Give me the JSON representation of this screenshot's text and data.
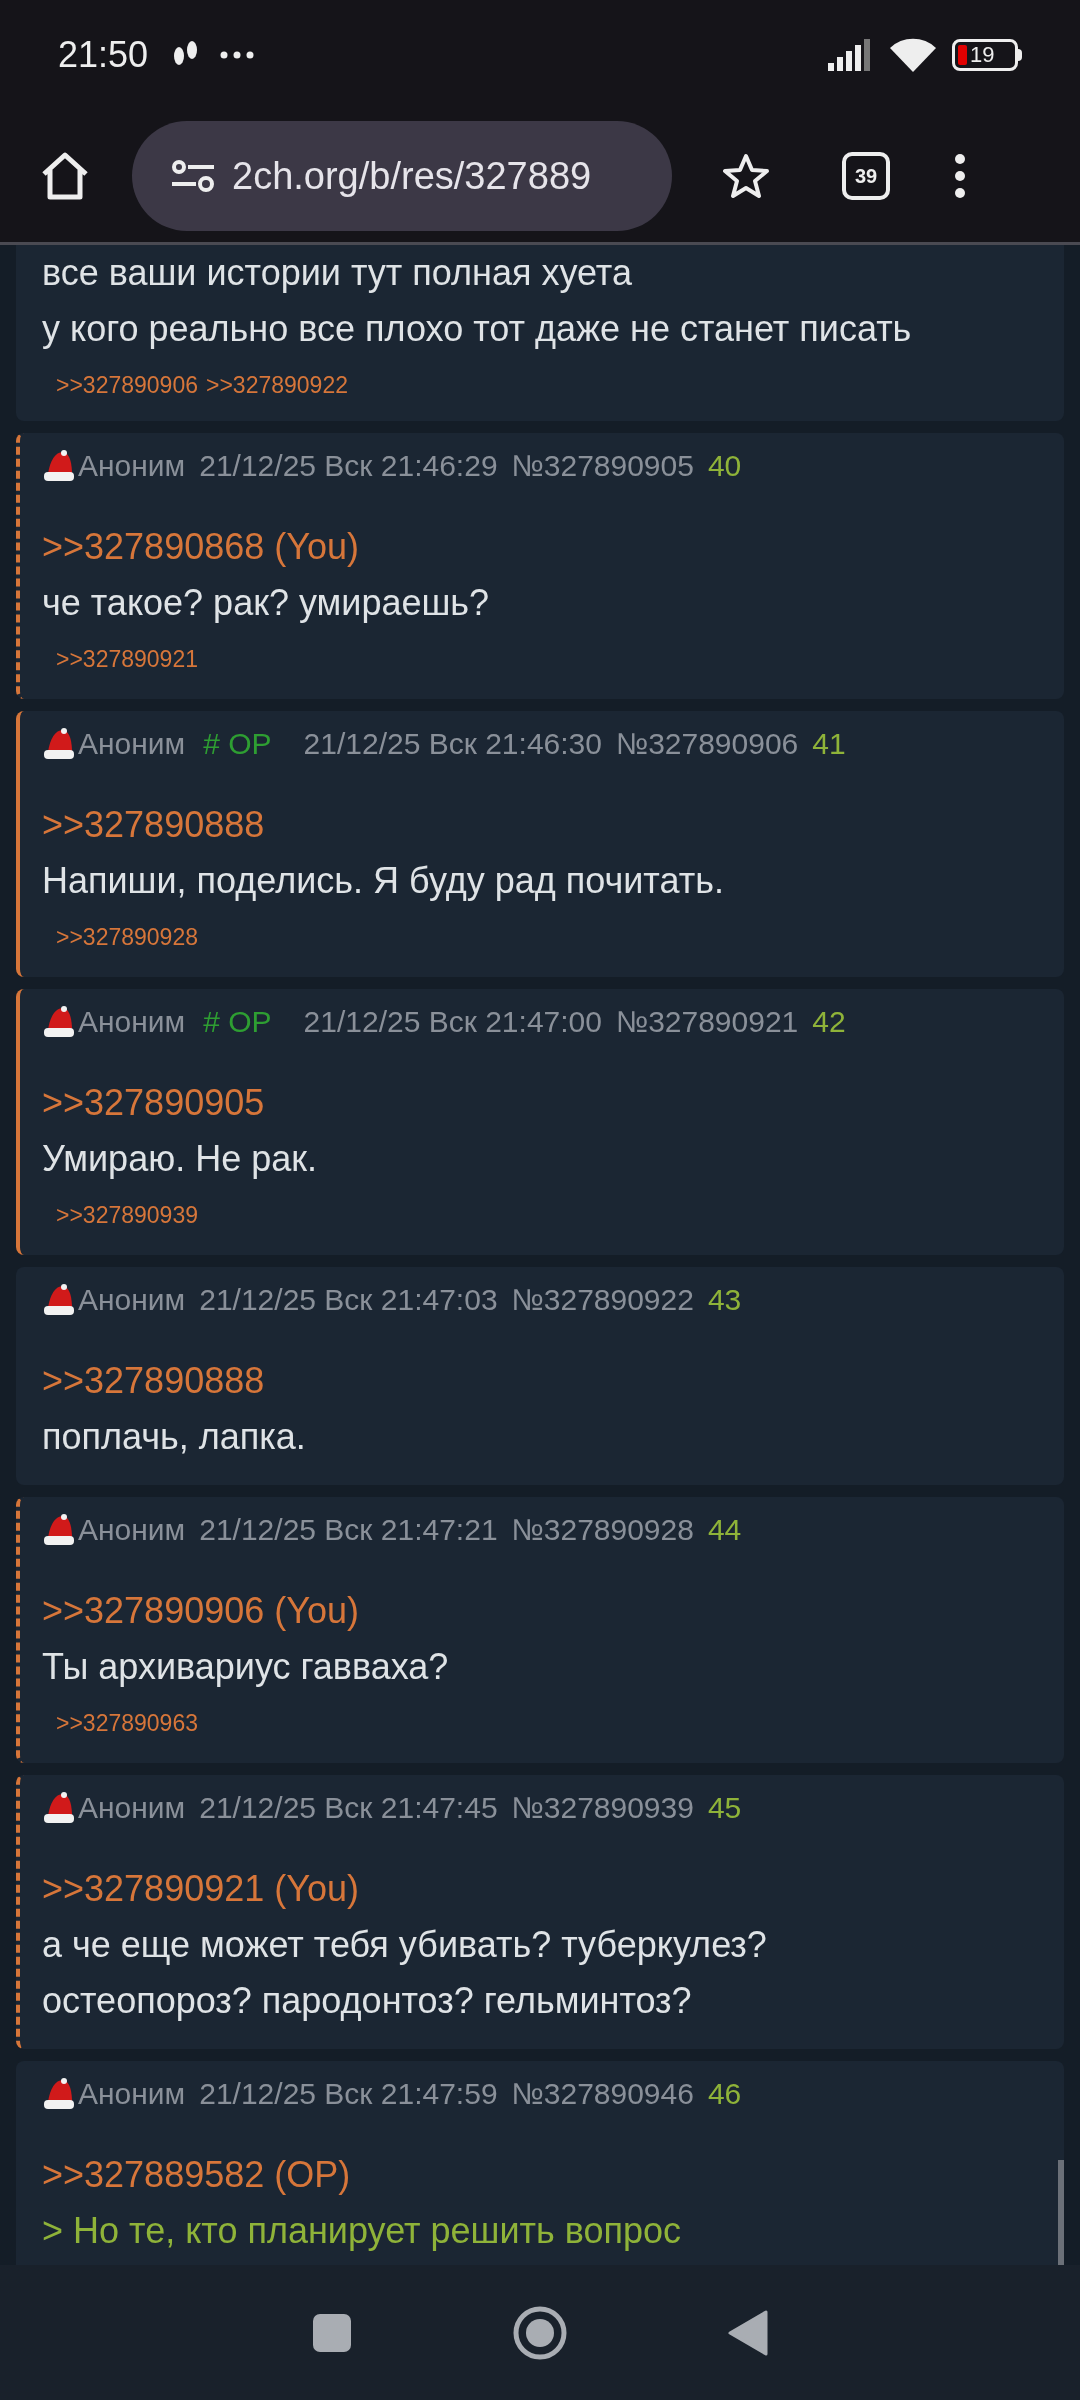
{
  "status_bar": {
    "time": "21:50",
    "battery": "19"
  },
  "browser": {
    "url": "2ch.org/b/res/327889",
    "tab_count": "39"
  },
  "posts": [
    {
      "kind": "cut",
      "body": [
        {
          "kind": "text",
          "text": "все ваши истории тут полная хуета"
        },
        {
          "kind": "text",
          "text": "у кого реально все плохо тот даже не станет писать"
        }
      ],
      "backlinks": [
        ">>327890906",
        ">>327890922"
      ]
    },
    {
      "kind": "reply",
      "name": "Аноним",
      "date": "21/12/25 Вск 21:46:29",
      "number": "№327890905",
      "index": "40",
      "body": [
        {
          "kind": "reply",
          "text": ">>327890868 (You)"
        },
        {
          "kind": "text",
          "text": "че такое? рак? умираешь?"
        }
      ],
      "backlinks": [
        ">>327890921"
      ]
    },
    {
      "kind": "op",
      "name": "Аноним",
      "trip": "# OP",
      "date": "21/12/25 Вск 21:46:30",
      "number": "№327890906",
      "index": "41",
      "body": [
        {
          "kind": "reply",
          "text": ">>327890888"
        },
        {
          "kind": "text",
          "text": "Напиши, поделись. Я буду рад почитать."
        }
      ],
      "backlinks": [
        ">>327890928"
      ]
    },
    {
      "kind": "op",
      "name": "Аноним",
      "trip": "# OP",
      "date": "21/12/25 Вск 21:47:00",
      "number": "№327890921",
      "index": "42",
      "body": [
        {
          "kind": "reply",
          "text": ">>327890905"
        },
        {
          "kind": "text",
          "text": "Умираю. Не рак."
        }
      ],
      "backlinks": [
        ">>327890939"
      ]
    },
    {
      "kind": "plain",
      "name": "Аноним",
      "date": "21/12/25 Вск 21:47:03",
      "number": "№327890922",
      "index": "43",
      "body": [
        {
          "kind": "reply",
          "text": ">>327890888"
        },
        {
          "kind": "text",
          "text": "поплачь, лапка."
        }
      ]
    },
    {
      "kind": "reply",
      "name": "Аноним",
      "date": "21/12/25 Вск 21:47:21",
      "number": "№327890928",
      "index": "44",
      "body": [
        {
          "kind": "reply",
          "text": ">>327890906 (You)"
        },
        {
          "kind": "text",
          "text": "Ты архивариус гавваха?"
        }
      ],
      "backlinks": [
        ">>327890963"
      ]
    },
    {
      "kind": "reply",
      "name": "Аноним",
      "date": "21/12/25 Вск 21:47:45",
      "number": "№327890939",
      "index": "45",
      "body": [
        {
          "kind": "reply",
          "text": ">>327890921 (You)"
        },
        {
          "kind": "text",
          "text": "а че еще может тебя убивать? туберкулез?"
        },
        {
          "kind": "text",
          "text": "остеопороз? пародонтоз? гельминтоз?"
        }
      ]
    },
    {
      "kind": "plain",
      "name": "Аноним",
      "date": "21/12/25 Вск 21:47:59",
      "number": "№327890946",
      "index": "46",
      "body": [
        {
          "kind": "reply",
          "text": ">>327889582 (OP)"
        },
        {
          "kind": "quote",
          "text": "> Но те, кто планирует решить вопрос"
        }
      ]
    }
  ]
}
